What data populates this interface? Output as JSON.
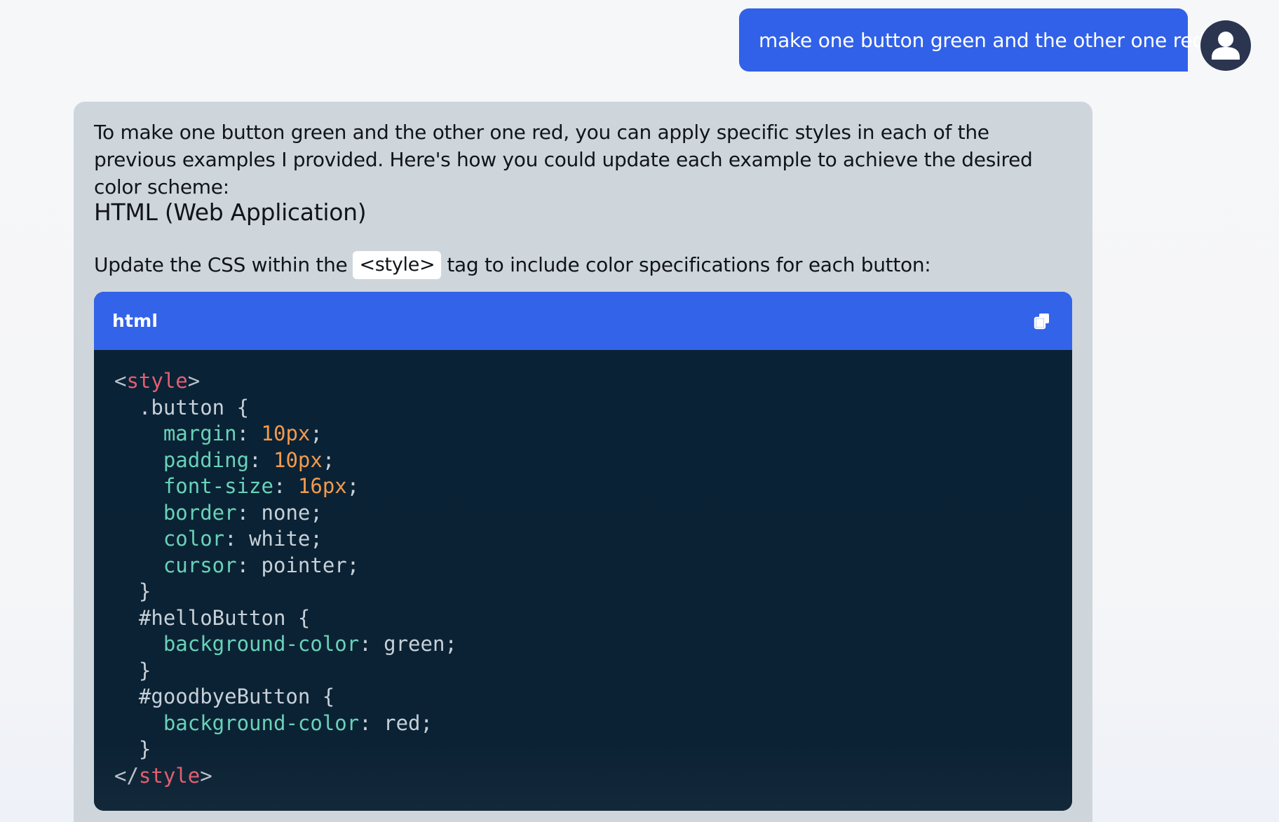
{
  "user_message": {
    "text": "make one button green and the other one red"
  },
  "assistant_message": {
    "intro": "To make one button green and the other one red, you can apply specific styles in each of the previous examples I provided. Here's how you could update each example to achieve the desired color scheme:",
    "heading": "HTML (Web Application)",
    "update_before": "Update the CSS within the",
    "inline_code": "<style>",
    "update_after": "tag to include color specifications for each button:",
    "code_block": {
      "language": "html",
      "copy_icon": "copy-icon",
      "lines": [
        [
          {
            "t": "<",
            "c": "punc"
          },
          {
            "t": "style",
            "c": "tag"
          },
          {
            "t": ">",
            "c": "punc"
          }
        ],
        [
          {
            "t": "  .button {",
            "c": "plain"
          }
        ],
        [
          {
            "t": "    ",
            "c": "plain"
          },
          {
            "t": "margin",
            "c": "prop"
          },
          {
            "t": ": ",
            "c": "plain"
          },
          {
            "t": "10px",
            "c": "num"
          },
          {
            "t": ";",
            "c": "plain"
          }
        ],
        [
          {
            "t": "    ",
            "c": "plain"
          },
          {
            "t": "padding",
            "c": "prop"
          },
          {
            "t": ": ",
            "c": "plain"
          },
          {
            "t": "10px",
            "c": "num"
          },
          {
            "t": ";",
            "c": "plain"
          }
        ],
        [
          {
            "t": "    ",
            "c": "plain"
          },
          {
            "t": "font-size",
            "c": "prop"
          },
          {
            "t": ": ",
            "c": "plain"
          },
          {
            "t": "16px",
            "c": "num"
          },
          {
            "t": ";",
            "c": "plain"
          }
        ],
        [
          {
            "t": "    ",
            "c": "plain"
          },
          {
            "t": "border",
            "c": "prop"
          },
          {
            "t": ": none;",
            "c": "plain"
          }
        ],
        [
          {
            "t": "    ",
            "c": "plain"
          },
          {
            "t": "color",
            "c": "prop"
          },
          {
            "t": ": white;",
            "c": "plain"
          }
        ],
        [
          {
            "t": "    ",
            "c": "plain"
          },
          {
            "t": "cursor",
            "c": "prop"
          },
          {
            "t": ": pointer;",
            "c": "plain"
          }
        ],
        [
          {
            "t": "  }",
            "c": "plain"
          }
        ],
        [
          {
            "t": "  #helloButton {",
            "c": "plain"
          }
        ],
        [
          {
            "t": "    ",
            "c": "plain"
          },
          {
            "t": "background-color",
            "c": "prop"
          },
          {
            "t": ": green;",
            "c": "plain"
          }
        ],
        [
          {
            "t": "  }",
            "c": "plain"
          }
        ],
        [
          {
            "t": "  #goodbyeButton {",
            "c": "plain"
          }
        ],
        [
          {
            "t": "    ",
            "c": "plain"
          },
          {
            "t": "background-color",
            "c": "prop"
          },
          {
            "t": ": red;",
            "c": "plain"
          }
        ],
        [
          {
            "t": "  }",
            "c": "plain"
          }
        ],
        [
          {
            "t": "</",
            "c": "punc"
          },
          {
            "t": "style",
            "c": "tag"
          },
          {
            "t": ">",
            "c": "punc"
          }
        ]
      ]
    }
  },
  "avatar_icon": "user-avatar-icon",
  "colors": {
    "accent": "#3161e8",
    "assistant_bg": "#ced6dc",
    "code_bg": "#0b2234"
  }
}
